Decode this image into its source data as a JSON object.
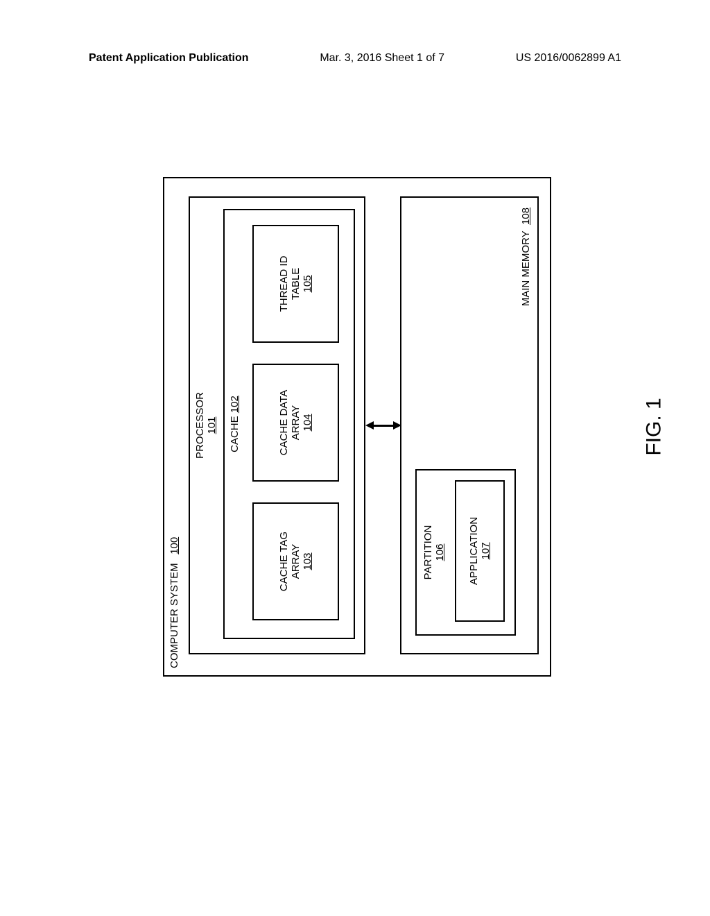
{
  "header": {
    "left": "Patent Application Publication",
    "center": "Mar. 3, 2016  Sheet 1 of 7",
    "right": "US 2016/0062899 A1"
  },
  "diagram": {
    "computer_system": {
      "label": "COMPUTER SYSTEM",
      "ref": "100"
    },
    "processor": {
      "label": "PROCESSOR",
      "ref": "101"
    },
    "cache": {
      "label": "CACHE",
      "ref": "102"
    },
    "cache_tag_array": {
      "label1": "CACHE TAG",
      "label2": "ARRAY",
      "ref": "103"
    },
    "cache_data_array": {
      "label1": "CACHE DATA",
      "label2": "ARRAY",
      "ref": "104"
    },
    "thread_id_table": {
      "label1": "THREAD ID",
      "label2": "TABLE",
      "ref": "105"
    },
    "main_memory": {
      "label": "MAIN MEMORY",
      "ref": "108"
    },
    "partition": {
      "label": "PARTITION",
      "ref": "106"
    },
    "application": {
      "label": "APPLICATION",
      "ref": "107"
    }
  },
  "figure_caption": "FIG. 1"
}
